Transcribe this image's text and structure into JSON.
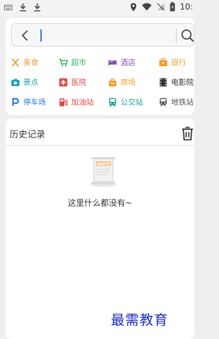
{
  "status_bar": {
    "time": "10:",
    "icons": [
      "keyboard-icon",
      "download-icon",
      "download-icon",
      "location-icon",
      "wifi-icon",
      "no-sim-icon",
      "battery-icon"
    ]
  },
  "search": {
    "placeholder": "",
    "back_icon": "chevron-left-icon",
    "search_icon": "search-icon"
  },
  "categories": [
    {
      "label": "美食",
      "icon": "food-icon",
      "color": "#f0a030"
    },
    {
      "label": "超市",
      "icon": "cart-icon",
      "color": "#2fb36a"
    },
    {
      "label": "酒店",
      "icon": "bed-icon",
      "color": "#7b4fb5"
    },
    {
      "label": "银行",
      "icon": "bank-icon",
      "color": "#f0a030"
    },
    {
      "label": "景点",
      "icon": "camera-icon",
      "color": "#1fa3a3"
    },
    {
      "label": "医院",
      "icon": "hospital-icon",
      "color": "#e04a4a"
    },
    {
      "label": "商场",
      "icon": "shopping-bag-icon",
      "color": "#f0a030"
    },
    {
      "label": "电影院",
      "icon": "film-icon",
      "color": "#333333"
    },
    {
      "label": "停车场",
      "icon": "parking-icon",
      "color": "#2a7ae2"
    },
    {
      "label": "加油站",
      "icon": "gas-station-icon",
      "color": "#e04a4a"
    },
    {
      "label": "公交站",
      "icon": "bus-icon",
      "color": "#1fa3a3"
    },
    {
      "label": "地铁站",
      "icon": "subway-icon",
      "color": "#555555"
    }
  ],
  "history": {
    "title": "历史记录",
    "empty_badge": "EMPTY",
    "empty_text": "这里什么都没有~"
  },
  "watermark": "最需教育"
}
